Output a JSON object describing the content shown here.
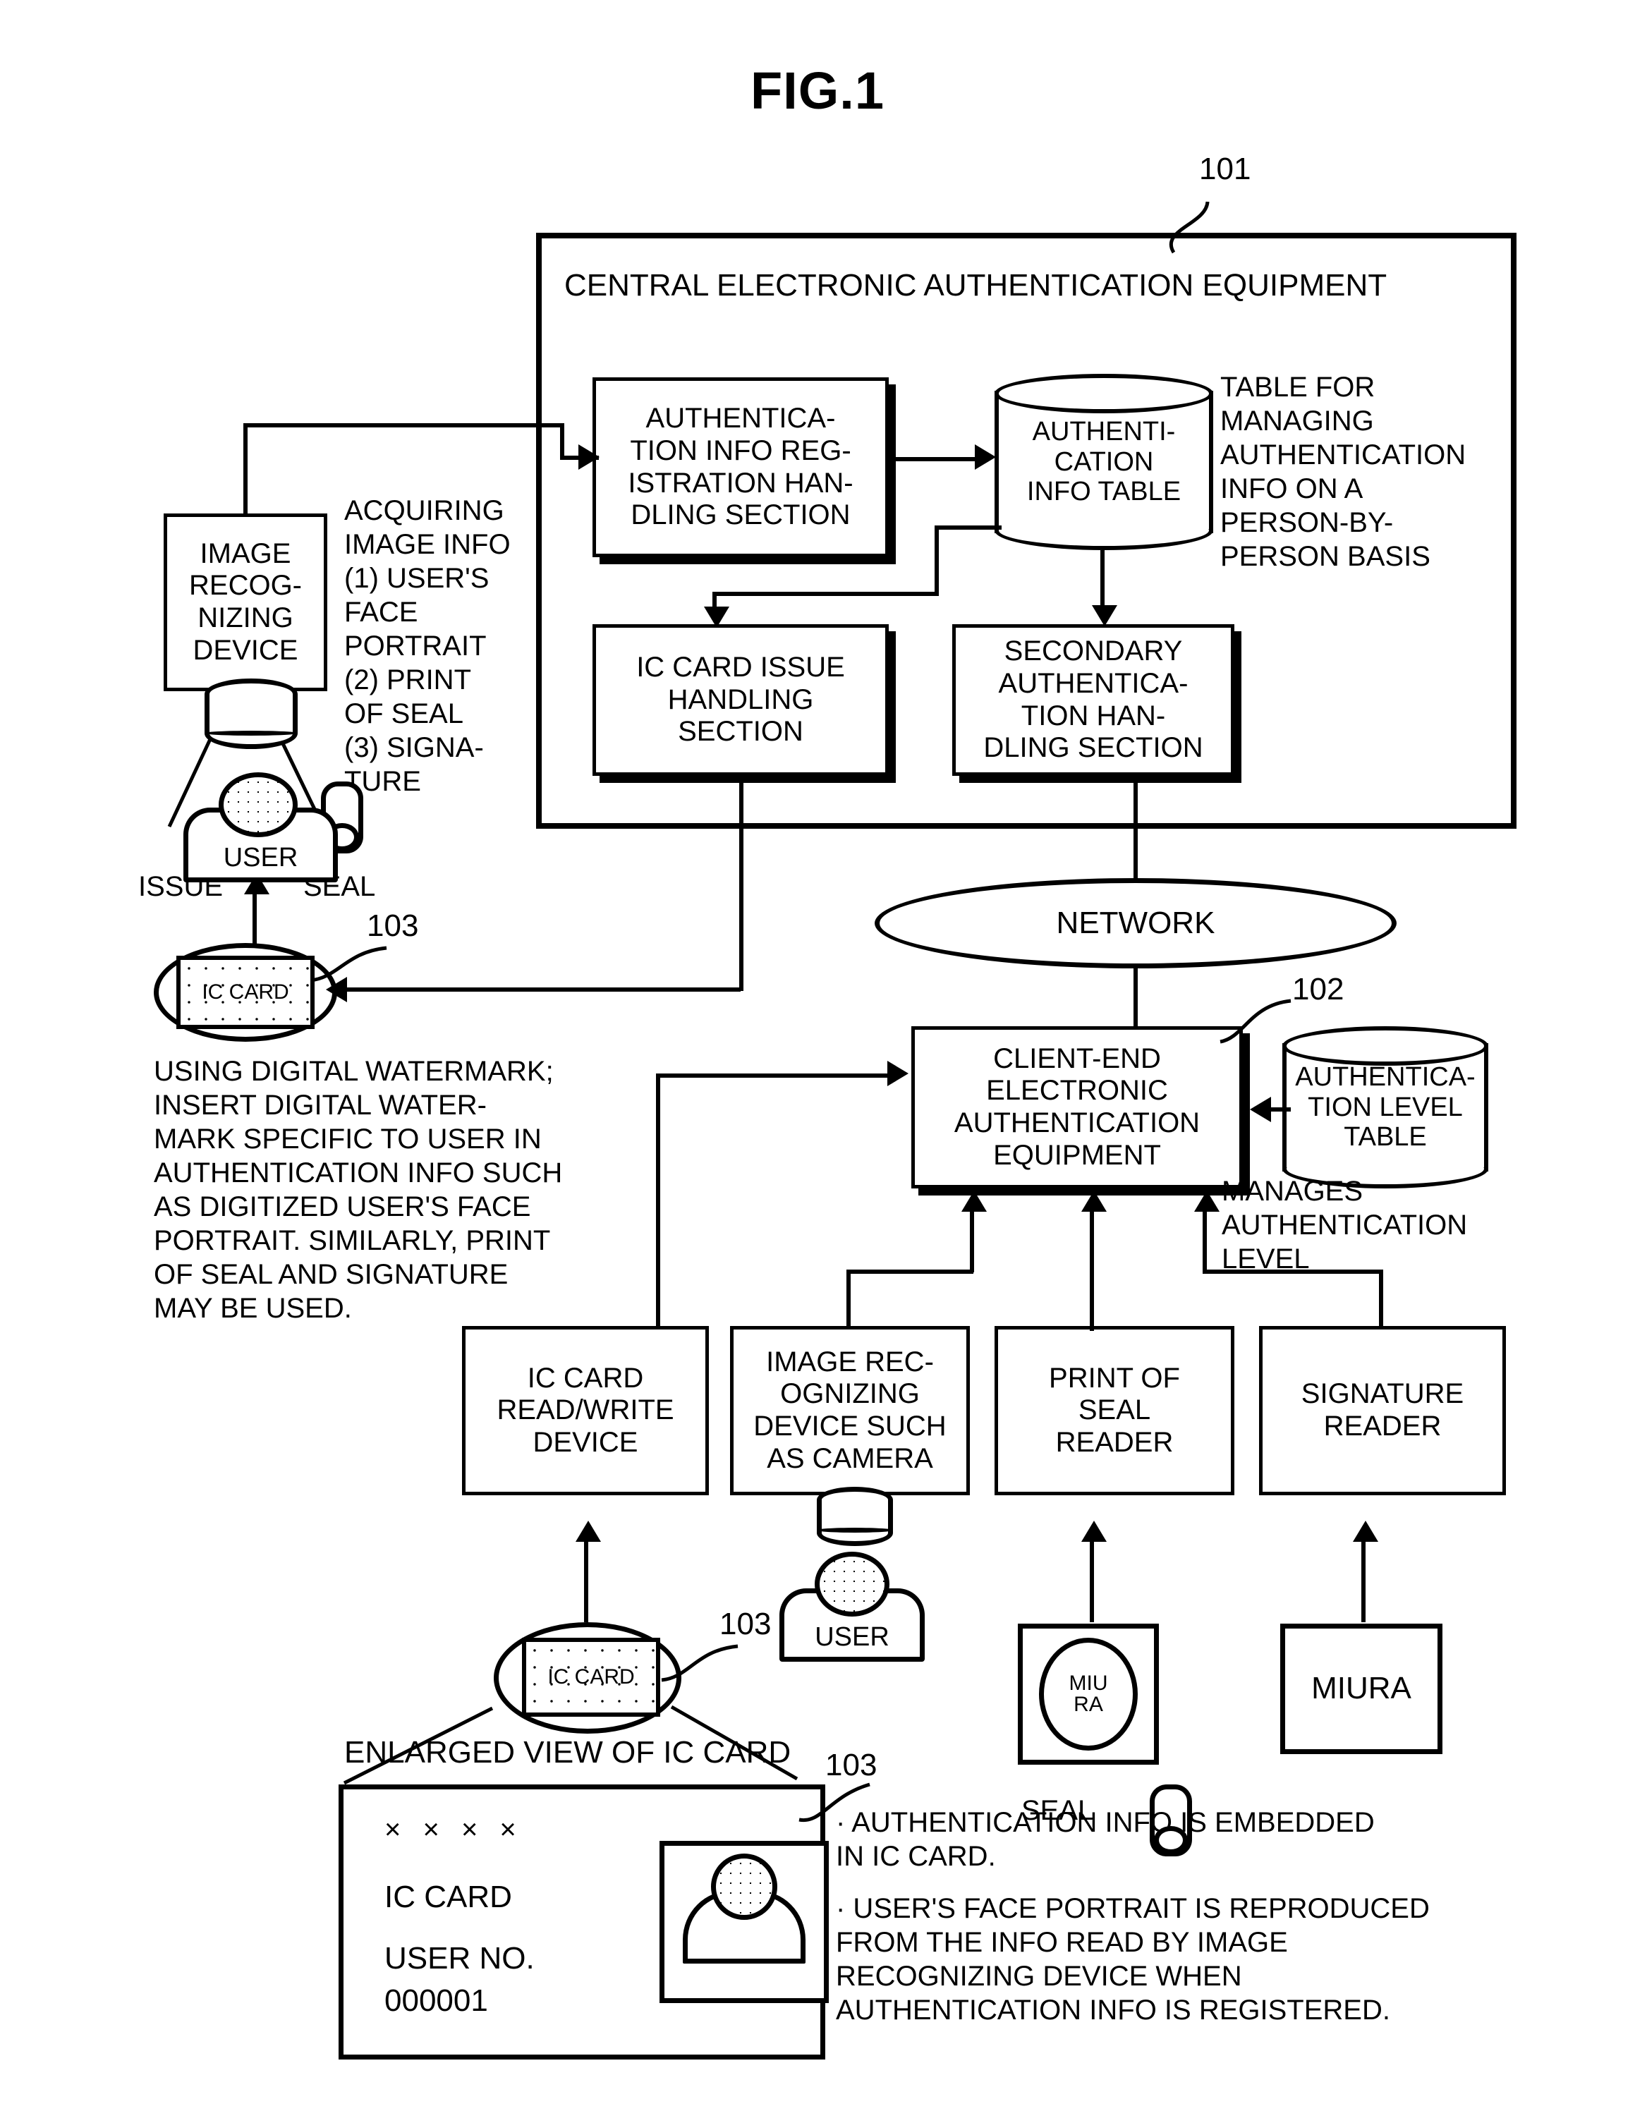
{
  "figure": {
    "title": "FIG.1"
  },
  "reference_numbers": {
    "central_equipment": "101",
    "client_equipment": "102",
    "ic_card_top": "103",
    "ic_card_bottom": "103",
    "ic_card_enlarged": "103"
  },
  "central": {
    "title": "CENTRAL ELECTRONIC AUTHENTICATION EQUIPMENT",
    "registration_section": "AUTHENTICA-\nTION INFO REG-\nISTRATION HAN-\nDLING SECTION",
    "info_table": "AUTHENTI-\nCATION\nINFO TABLE",
    "info_table_note": "TABLE FOR\nMANAGING\nAUTHENTICATION\nINFO ON A\nPERSON-BY-\nPERSON BASIS",
    "ic_card_issue_section": "IC CARD ISSUE\nHANDLING\nSECTION",
    "secondary_auth_section": "SECONDARY\nAUTHENTICA-\nTION HAN-\nDLING SECTION"
  },
  "left": {
    "image_recognizing_device": "IMAGE\nRECOG-\nNIZING\nDEVICE",
    "acquiring_info": "ACQUIRING\nIMAGE INFO\n(1) USER'S\n FACE\n PORTRAIT\n(2) PRINT\n OF SEAL\n(3) SIGNA-\n TURE",
    "user_label": "USER",
    "seal_label": "SEAL",
    "issue_label": "ISSUE",
    "ic_card_label": "IC\nCARD",
    "watermark_note": "USING DIGITAL WATERMARK;\nINSERT DIGITAL WATER-\nMARK SPECIFIC TO USER IN\nAUTHENTICATION INFO SUCH\nAS DIGITIZED USER'S FACE\nPORTRAIT. SIMILARLY, PRINT\nOF SEAL AND SIGNATURE\nMAY BE USED."
  },
  "network": {
    "label": "NETWORK"
  },
  "client": {
    "title": "CLIENT-END\nELECTRONIC\nAUTHENTICATION\nEQUIPMENT",
    "auth_level_table": "AUTHENTICA-\nTION LEVEL\nTABLE",
    "manages_note": "MANAGES\nAUTHENTICATION\nLEVEL"
  },
  "devices": [
    {
      "name": "ic-card-read-write-device",
      "label": "IC CARD\nREAD/WRITE\nDEVICE"
    },
    {
      "name": "image-recognizing-device-camera",
      "label": "IMAGE REC-\nOGNIZING\nDEVICE SUCH\nAS CAMERA"
    },
    {
      "name": "print-of-seal-reader",
      "label": "PRINT OF\nSEAL\nREADER"
    },
    {
      "name": "signature-reader",
      "label": "SIGNATURE\nREADER"
    }
  ],
  "bottom": {
    "ic_card_label": "IC\nCARD",
    "user_label": "USER",
    "seal_stamp_text": "MIU\nRA",
    "seal_caption": "SEAL",
    "signature_text": "MIURA",
    "enlarged_caption": "ENLARGED VIEW OF IC CARD"
  },
  "enlarged_card": {
    "mask_line": "× × × ×",
    "card_label": "IC CARD",
    "user_no_label": "USER NO.",
    "user_no_value": "000001"
  },
  "notes": {
    "bullet_1": "· AUTHENTICATION INFO IS EMBEDDED\n  IN IC CARD.",
    "bullet_2": "· USER'S FACE PORTRAIT IS REPRODUCED\n  FROM THE INFO READ BY IMAGE\n  RECOGNIZING DEVICE WHEN\n  AUTHENTICATION INFO IS REGISTERED."
  },
  "colors": {
    "ink": "#000000",
    "paper": "#ffffff"
  }
}
